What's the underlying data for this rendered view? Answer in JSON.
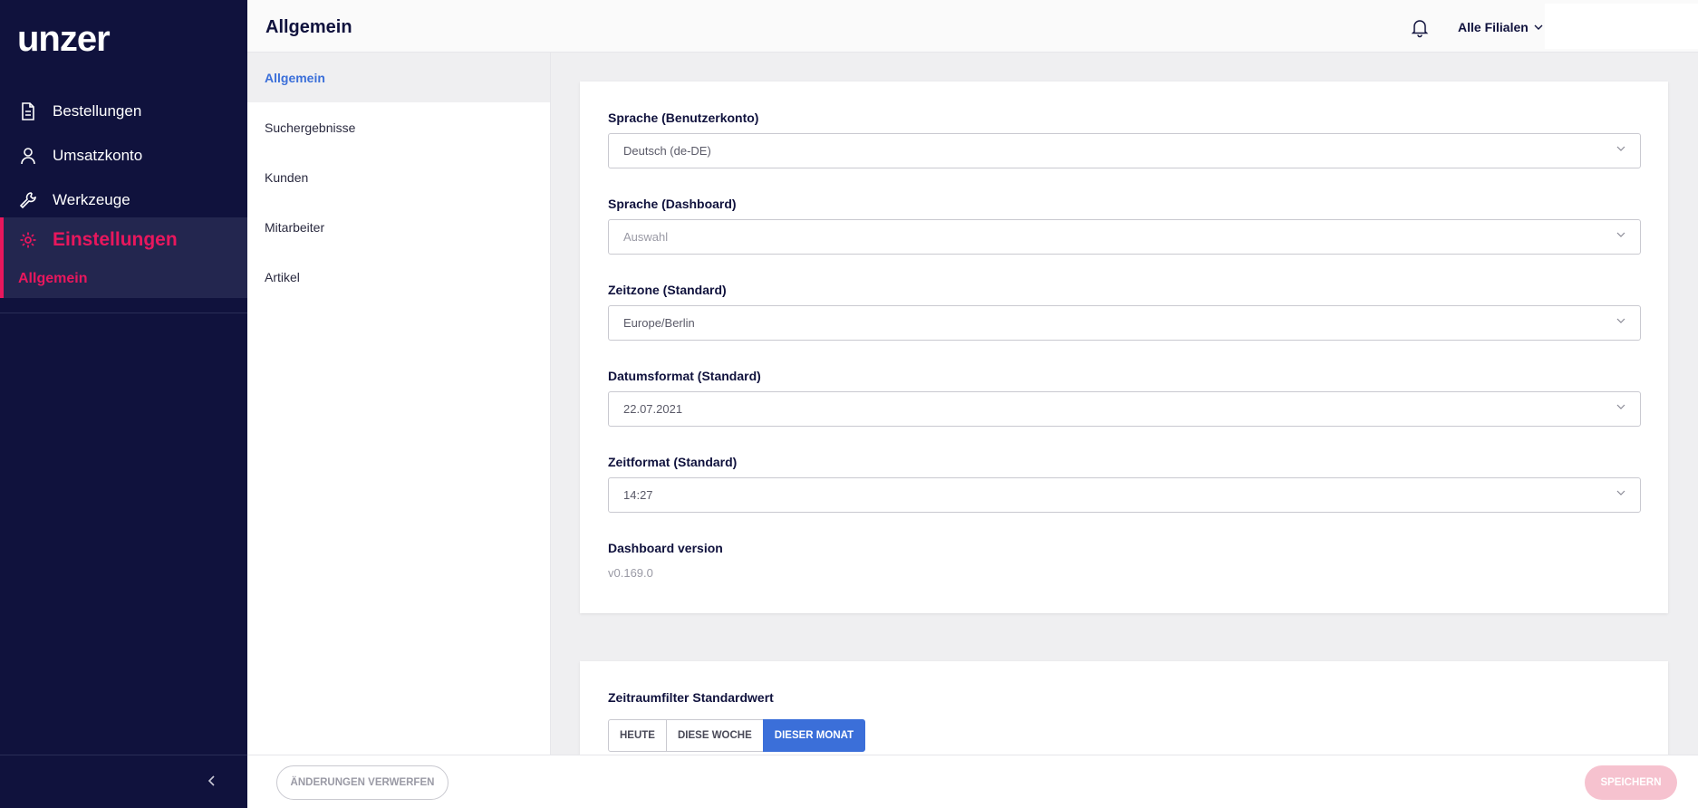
{
  "brand": {
    "logo_text": "unzer",
    "accent": "#e8175d",
    "sidebar_bg": "#10123d",
    "primary": "#3b6fd9"
  },
  "sidebar": {
    "items": [
      {
        "label": "Bestellungen",
        "icon": "document-icon"
      },
      {
        "label": "Umsatzkonto",
        "icon": "user-icon"
      },
      {
        "label": "Werkzeuge",
        "icon": "wrench-icon"
      }
    ],
    "active": {
      "label": "Einstellungen",
      "icon": "gear-icon",
      "sub_label": "Allgemein"
    }
  },
  "header": {
    "title": "Allgemein",
    "branch_selector": "Alle Filialen"
  },
  "subnav": {
    "items": [
      {
        "label": "Allgemein",
        "active": true
      },
      {
        "label": "Suchergebnisse"
      },
      {
        "label": "Kunden"
      },
      {
        "label": "Mitarbeiter"
      },
      {
        "label": "Artikel"
      }
    ]
  },
  "settings": {
    "account_language": {
      "label": "Sprache (Benutzerkonto)",
      "value": "Deutsch (de-DE)"
    },
    "dashboard_language": {
      "label": "Sprache (Dashboard)",
      "placeholder": "Auswahl"
    },
    "timezone": {
      "label": "Zeitzone (Standard)",
      "value": "Europe/Berlin"
    },
    "date_format": {
      "label": "Datumsformat (Standard)",
      "value": "22.07.2021"
    },
    "time_format": {
      "label": "Zeitformat (Standard)",
      "value": "14:27"
    },
    "version": {
      "label": "Dashboard version",
      "value": "v0.169.0"
    }
  },
  "period_filter": {
    "label": "Zeitraumfilter Standardwert",
    "options": [
      "HEUTE",
      "DIESE WOCHE",
      "DIESER MONAT"
    ],
    "selected": "DIESER MONAT"
  },
  "footer": {
    "discard_label": "ÄNDERUNGEN VERWERFEN",
    "save_label": "SPEICHERN"
  }
}
